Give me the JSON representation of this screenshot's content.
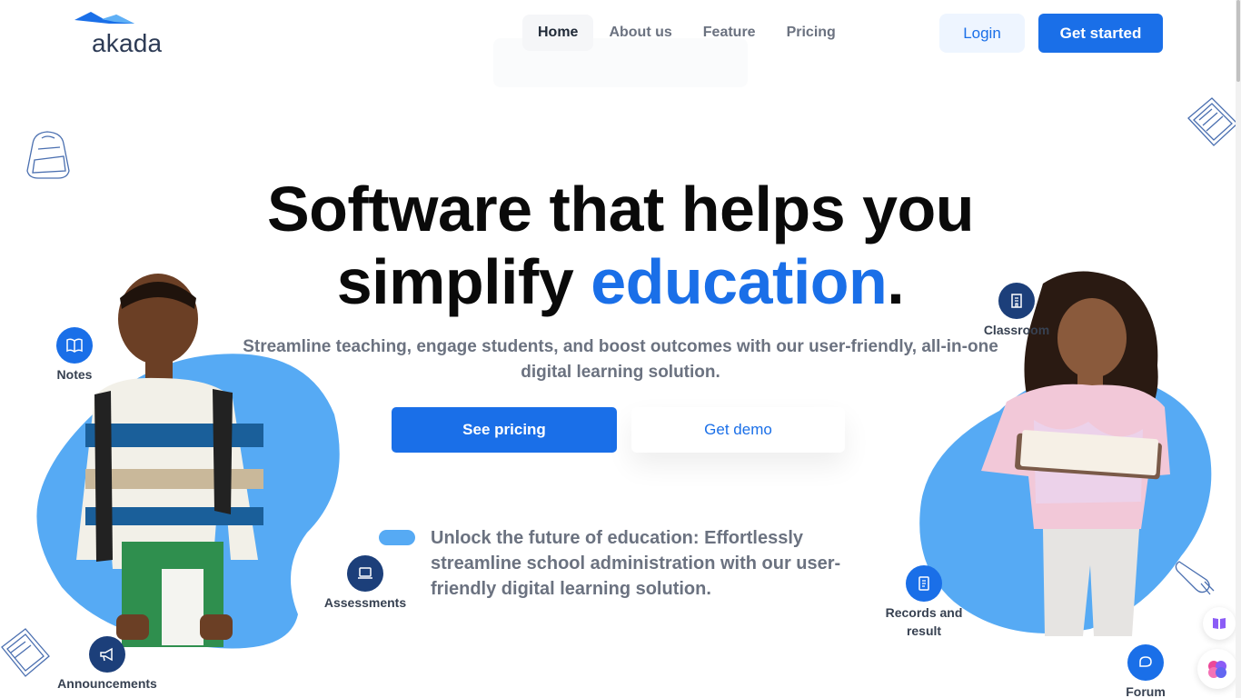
{
  "brand": {
    "name": "akada",
    "accent_color": "#1a6fe8",
    "dark_circle_color": "#1c3f7a",
    "blob_color": "#56aaf4"
  },
  "nav": {
    "items": [
      {
        "label": "Home",
        "active": true
      },
      {
        "label": "About us",
        "active": false
      },
      {
        "label": "Feature",
        "active": false
      },
      {
        "label": "Pricing",
        "active": false
      }
    ],
    "login_label": "Login",
    "get_started_label": "Get started"
  },
  "hero": {
    "title_line1": "Software that helps you",
    "title_line2_prefix": "simplify ",
    "title_line2_accent": "education",
    "title_line2_suffix": ".",
    "subtitle": "Streamline teaching, engage students, and boost outcomes with our user-friendly, all-in-one digital learning solution.",
    "primary_cta": "See pricing",
    "secondary_cta": "Get demo",
    "unlock_text": "Unlock the future of education: Effortlessly streamline school administration with our user-friendly digital learning solution."
  },
  "features": {
    "notes": {
      "label": "Notes",
      "icon": "book-open-icon"
    },
    "announcements": {
      "label": "Announcements",
      "icon": "megaphone-icon"
    },
    "assessments": {
      "label": "Assessments",
      "icon": "laptop-icon"
    },
    "classroom": {
      "label": "Classroom",
      "icon": "building-icon"
    },
    "records": {
      "label": "Records and result",
      "icon": "document-icon"
    },
    "forum": {
      "label": "Forum",
      "icon": "chat-bubble-icon"
    }
  }
}
